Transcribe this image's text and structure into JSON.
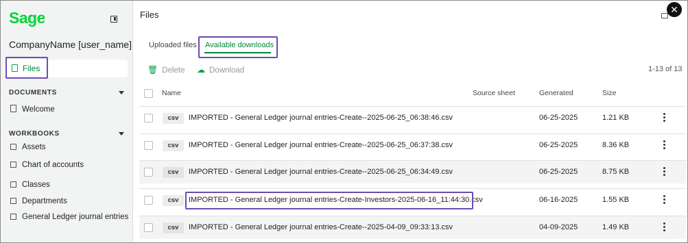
{
  "sidebar": {
    "brand": "Sage",
    "company": "CompanyName [user_name]",
    "files_label": "Files",
    "documents_heading": "DOCUMENTS",
    "documents": [
      "Welcome"
    ],
    "workbooks_heading": "WORKBOOKS",
    "workbooks": [
      "Assets",
      "Chart of accounts",
      "Classes",
      "Departments",
      "General Ledger journal entries"
    ]
  },
  "main": {
    "title": "Files",
    "tabs": [
      {
        "label": "Uploaded files"
      },
      {
        "label": "Available downloads",
        "active": true
      }
    ],
    "toolbar": {
      "delete_label": "Delete",
      "download_label": "Download"
    },
    "pager": "1-13 of 13",
    "columns": {
      "name": "Name",
      "source": "Source sheet",
      "generated": "Generated",
      "size": "Size"
    },
    "rows": [
      {
        "type": "csv",
        "name": "IMPORTED - General Ledger journal entries-Create--2025-06-25_06:38:46.csv",
        "generated": "06-25-2025",
        "size": "1.21 KB"
      },
      {
        "type": "csv",
        "name": "IMPORTED - General Ledger journal entries-Create--2025-06-25_06:37:38.csv",
        "generated": "06-25-2025",
        "size": "8.36 KB"
      },
      {
        "type": "csv",
        "name": "IMPORTED - General Ledger journal entries-Create--2025-06-25_06:34:49.csv",
        "generated": "06-25-2025",
        "size": "8.75 KB"
      },
      {
        "type": "csv",
        "name": "IMPORTED - General Ledger journal entries-Create-Investors-2025-06-16_11:44:30.csv",
        "generated": "06-16-2025",
        "size": "1.55 KB"
      },
      {
        "type": "csv",
        "name": "IMPORTED - General Ledger journal entries-Create--2025-04-09_09:33:13.csv",
        "generated": "04-09-2025",
        "size": "1.49 KB"
      }
    ]
  },
  "colors": {
    "brand_green": "#00a14b",
    "highlight": "#6a4bb4"
  },
  "icons": [
    "files-icon",
    "collapse-sidebar-icon",
    "document-icon",
    "sheet-icon",
    "trash-icon",
    "cloud-download-icon",
    "kebab-menu-icon",
    "close-icon",
    "chat-icon"
  ]
}
